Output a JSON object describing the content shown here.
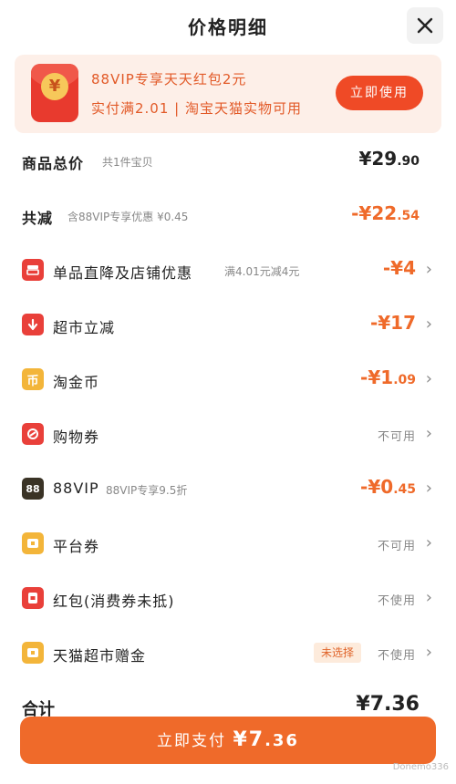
{
  "header": {
    "title": "价格明细",
    "close_icon": "close-icon"
  },
  "promo": {
    "icon": "red-packet-icon",
    "coin_symbol": "¥",
    "line1": "88VIP专享天天红包2元",
    "line2": "实付满2.01 | 淘宝天猫实物可用",
    "button": "立即使用",
    "accent": "#ef4a26"
  },
  "summary": {
    "goods_total": {
      "label": "商品总价",
      "sub": "共1件宝贝",
      "value_int": "¥29",
      "value_dec": ".90"
    },
    "total_discount": {
      "label": "共减",
      "sub": "含88VIP专享优惠 ¥0.45",
      "value_int": "-¥22",
      "value_dec": ".54"
    }
  },
  "discounts": [
    {
      "label": "单品直降及店铺优惠",
      "sub": "满4.01元减4元",
      "value_int": "-¥4",
      "value_dec": "",
      "status": "",
      "tag": "",
      "icon": "shop-discount-icon",
      "color": "#e9403a"
    },
    {
      "label": "超市立减",
      "sub": "",
      "value_int": "-¥17",
      "value_dec": "",
      "status": "",
      "tag": "",
      "icon": "arrow-down-icon",
      "color": "#e9403a"
    },
    {
      "label": "淘金币",
      "sub": "",
      "value_int": "-¥1",
      "value_dec": ".09",
      "status": "",
      "tag": "",
      "icon": "coin-icon",
      "color": "#f3b53a"
    },
    {
      "label": "购物券",
      "sub": "",
      "value_int": "",
      "value_dec": "",
      "status": "不可用",
      "tag": "",
      "icon": "coupon-icon",
      "color": "#e9403a"
    },
    {
      "label": "88VIP",
      "sub": "88VIP专享9.5折",
      "value_int": "-¥0",
      "value_dec": ".45",
      "status": "",
      "tag": "",
      "icon": "vip-88-icon",
      "color": "#3a3326"
    },
    {
      "label": "平台券",
      "sub": "",
      "value_int": "",
      "value_dec": "",
      "status": "不可用",
      "tag": "",
      "icon": "platform-coupon-icon",
      "color": "#f3b53a"
    },
    {
      "label": "红包(消费券未抵)",
      "sub": "",
      "value_int": "",
      "value_dec": "",
      "status": "不使用",
      "tag": "",
      "icon": "red-envelope-icon",
      "color": "#e9403a"
    },
    {
      "label": "天猫超市赠金",
      "sub": "",
      "value_int": "",
      "value_dec": "",
      "status": "不使用",
      "tag": "未选择",
      "icon": "gift-gold-icon",
      "color": "#f3b53a"
    }
  ],
  "total": {
    "label": "合计",
    "value": "¥7.36"
  },
  "pay": {
    "label": "立即支付",
    "amount_int": "¥7",
    "amount_dec": ".36"
  },
  "watermark": "Donemo336"
}
